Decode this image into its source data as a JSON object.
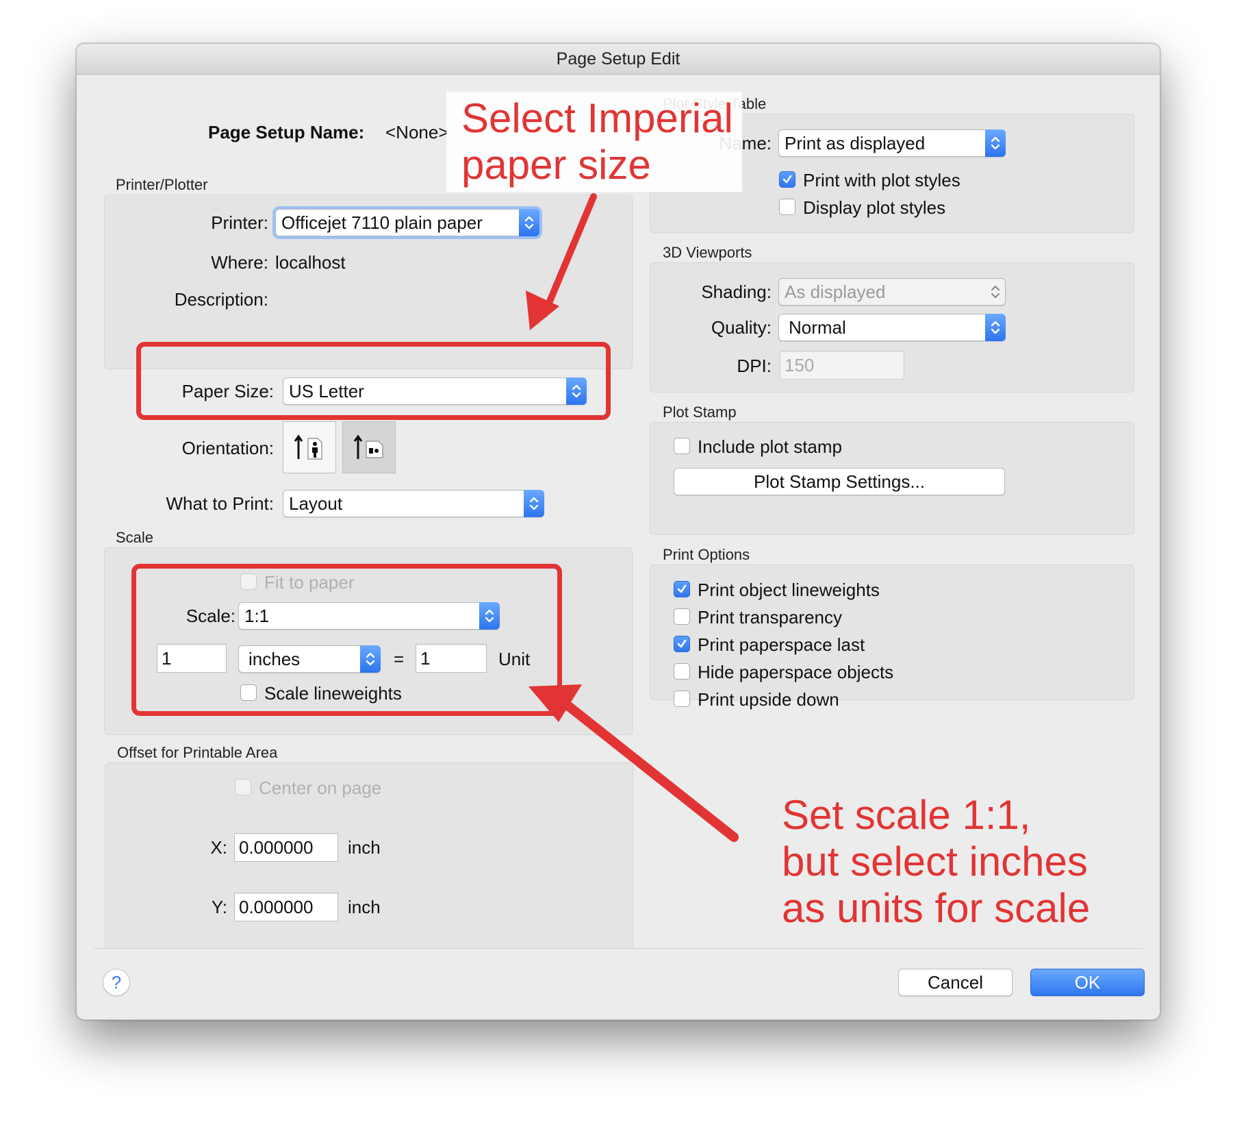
{
  "window": {
    "title": "Page Setup Edit"
  },
  "page_setup": {
    "name_label": "Page Setup Name:",
    "name_value": "<None>"
  },
  "printer_plotter": {
    "group_label": "Printer/Plotter",
    "printer_label": "Printer:",
    "printer_value": "Officejet 7110 plain paper",
    "where_label": "Where:",
    "where_value": "localhost",
    "description_label": "Description:"
  },
  "paper": {
    "label": "Paper Size:",
    "value": "US Letter"
  },
  "orientation": {
    "label": "Orientation:",
    "selected": "landscape"
  },
  "what_to_print": {
    "label": "What to Print:",
    "value": "Layout"
  },
  "scale": {
    "group_label": "Scale",
    "fit_to_paper": "Fit to paper",
    "scale_label": "Scale:",
    "scale_value": "1:1",
    "left_value": "1",
    "units_value": "inches",
    "equals": "=",
    "right_value": "1",
    "unit_label": "Unit",
    "scale_lineweights": "Scale lineweights"
  },
  "offset": {
    "group_label": "Offset for Printable Area",
    "center_on_page": "Center on page",
    "x_label": "X:",
    "x_value": "0.000000",
    "y_label": "Y:",
    "y_value": "0.000000",
    "unit": "inch"
  },
  "plot_style_table": {
    "group_label": "Plot Style Table",
    "name_label": "Name:",
    "name_value": "Print as displayed",
    "print_with_plot_styles": "Print with plot styles",
    "display_plot_styles": "Display plot styles"
  },
  "viewports": {
    "group_label": "3D Viewports",
    "shading_label": "Shading:",
    "shading_value": "As displayed",
    "quality_label": "Quality:",
    "quality_value": "Normal",
    "dpi_label": "DPI:",
    "dpi_value": "150"
  },
  "plot_stamp": {
    "group_label": "Plot Stamp",
    "include": "Include plot stamp",
    "settings_button": "Plot Stamp Settings..."
  },
  "print_options": {
    "group_label": "Print Options",
    "items": [
      {
        "label": "Print object lineweights",
        "checked": true
      },
      {
        "label": "Print transparency",
        "checked": false
      },
      {
        "label": "Print paperspace last",
        "checked": true
      },
      {
        "label": "Hide paperspace objects",
        "checked": false
      },
      {
        "label": "Print upside down",
        "checked": false
      }
    ]
  },
  "footer": {
    "help": "?",
    "cancel": "Cancel",
    "ok": "OK"
  },
  "annotations": {
    "paper_note": [
      "Select Imperial",
      "paper size"
    ],
    "scale_note": [
      "Set scale 1:1,",
      "but select inches",
      "as units for scale"
    ]
  },
  "colors": {
    "annotation_red": "#e23434",
    "accent_blue": "#2f77ef"
  }
}
